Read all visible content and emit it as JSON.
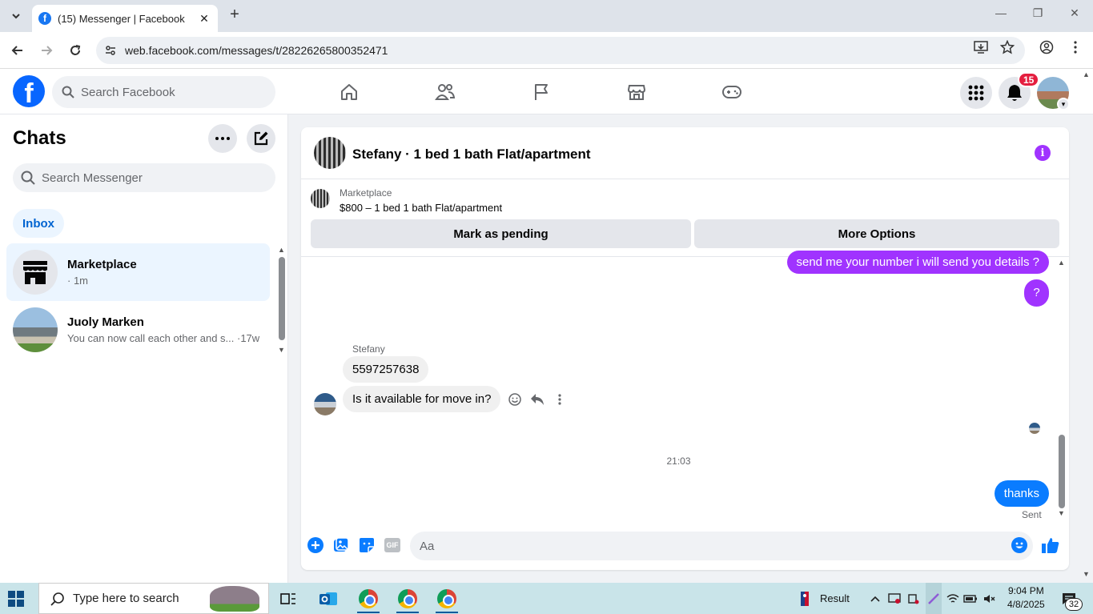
{
  "browser": {
    "tab_title": "(15) Messenger | Facebook",
    "tab_close": "✕",
    "new_tab": "+",
    "url": "web.facebook.com/messages/t/28226265800352471"
  },
  "fb_header": {
    "logo_letter": "f",
    "search_placeholder": "Search Facebook",
    "notification_count": "15"
  },
  "chats_panel": {
    "title": "Chats",
    "search_placeholder": "Search Messenger",
    "filter_label": "Inbox",
    "items": [
      {
        "name": "Marketplace",
        "preview": "· 1m",
        "active": true
      },
      {
        "name": "Juoly Marken",
        "preview": "You can now call each other and s... ·17w",
        "active": false
      }
    ]
  },
  "conversation": {
    "title": "Stefany · 1 bed 1 bath Flat/apartment",
    "marketplace_label": "Marketplace",
    "listing": "$800 – 1 bed 1 bath Flat/apartment",
    "mark_pending_label": "Mark as pending",
    "more_options_label": "More Options",
    "info_glyph": "i",
    "messages": {
      "out_1": "send me your number i will send you details ?",
      "out_2": "?",
      "sender": "Stefany",
      "in_1": "5597257638",
      "in_2": "Is it available for move in?",
      "timestamp": "21:03",
      "out_3": "thanks",
      "status": "Sent"
    },
    "composer_placeholder": "Aa",
    "gif_label": "GIF"
  },
  "taskbar": {
    "search_placeholder": "Type here to search",
    "news_label": "Result",
    "time": "9:04 PM",
    "date": "4/8/2025",
    "notification_count": "32"
  }
}
